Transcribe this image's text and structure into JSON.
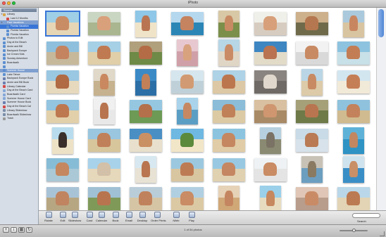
{
  "window": {
    "title": "iPhoto"
  },
  "colors": {
    "close": "#ff5f57",
    "minimize": "#febc2e",
    "zoom": "#28c840",
    "selection": "#3875d7"
  },
  "sidebar": {
    "header": "Source",
    "items": [
      {
        "label": "Library",
        "icon": "library-icon",
        "indent": 0,
        "disclosure": true
      },
      {
        "label": "Last 12 Months",
        "icon": "calendar-icon",
        "indent": 1
      },
      {
        "label": "Past Vacations",
        "icon": "folder-icon",
        "indent": 0,
        "disclosure": true,
        "state": "selected"
      },
      {
        "label": "Florida Vacation",
        "icon": "album-icon",
        "indent": 1,
        "state": "active"
      },
      {
        "label": "Florida Vacation",
        "icon": "album-icon",
        "indent": 1
      },
      {
        "label": "Florida Vacation",
        "icon": "album-icon",
        "indent": 1
      },
      {
        "label": "Photos to Edit",
        "icon": "album-icon",
        "indent": 0
      },
      {
        "label": "Day at the Beach",
        "icon": "album-icon",
        "indent": 0
      },
      {
        "label": "Annie and Bill",
        "icon": "album-icon",
        "indent": 0
      },
      {
        "label": "Backpack Europe",
        "icon": "album-icon",
        "indent": 0
      },
      {
        "label": "Ice Cream Kids",
        "icon": "album-icon",
        "indent": 0
      },
      {
        "label": "Sunday Adventure",
        "icon": "album-icon",
        "indent": 0
      },
      {
        "label": "Boardwalk",
        "icon": "album-icon",
        "indent": 0
      },
      {
        "label": "",
        "icon": "album-icon",
        "indent": 0
      },
      {
        "label": "Summer House",
        "icon": "album-icon",
        "indent": 0,
        "state": "selected"
      },
      {
        "label": "Lake Tahoe",
        "icon": "album-icon",
        "indent": 0
      },
      {
        "label": "Backpack Europe Book",
        "icon": "book-icon",
        "indent": 0
      },
      {
        "label": "Annie and Bill Book",
        "icon": "book-icon",
        "indent": 0
      },
      {
        "label": "Library Calendar",
        "icon": "calendar-icon",
        "indent": 0
      },
      {
        "label": "Day at the Beach Card",
        "icon": "card-icon",
        "indent": 0
      },
      {
        "label": "Boardwalk Card",
        "icon": "card-icon",
        "indent": 0
      },
      {
        "label": "Summer House Card",
        "icon": "card-icon",
        "indent": 0
      },
      {
        "label": "Summer House Book",
        "icon": "book-icon",
        "indent": 0
      },
      {
        "label": "Day at the Beach Cal",
        "icon": "calendar-icon",
        "indent": 0
      },
      {
        "label": "Library Slideshow",
        "icon": "slideshow-icon",
        "indent": 0
      },
      {
        "label": "Boardwalk Slideshow",
        "icon": "slideshow-icon",
        "indent": 0
      },
      {
        "label": "Trash",
        "icon": "trash-icon",
        "indent": 0
      }
    ]
  },
  "toolbar": [
    {
      "label": "Rotate",
      "icon": "rotate-icon"
    },
    {
      "label": "Edit",
      "icon": "edit-icon"
    },
    {
      "label": "Slideshow",
      "icon": "slideshow-icon"
    },
    {
      "label": "Card",
      "icon": "card-icon"
    },
    {
      "label": "Calendar",
      "icon": "calendar-icon"
    },
    {
      "label": "Book",
      "icon": "book-icon"
    },
    {
      "label": "Email",
      "icon": "email-icon"
    },
    {
      "label": "Desktop",
      "icon": "desktop-icon"
    },
    {
      "label": "Order Prints",
      "icon": "order-prints-icon"
    },
    {
      "label": "iWeb",
      "icon": "iweb-icon"
    },
    {
      "label": "Play",
      "icon": "play-icon"
    }
  ],
  "search": {
    "label": "Search",
    "placeholder": ""
  },
  "status": {
    "count_text": "1 of 54 photos"
  },
  "zoom": {
    "level": 0.5
  },
  "bottom_buttons": [
    {
      "label": "+",
      "icon": "add-icon"
    },
    {
      "label": "i",
      "icon": "info-icon"
    },
    {
      "label": "▦",
      "icon": "view-icon"
    },
    {
      "label": "↻",
      "icon": "rotate-icon"
    }
  ],
  "photos": [
    {
      "subject": "kids-on-beach",
      "sky": "#9ecfe6",
      "ground": "#e6d6b6",
      "skin": "#c98d66"
    },
    {
      "subject": "couple-smiling",
      "sky": "#c9d6c2",
      "ground": "#a9b68f",
      "skin": "#d9a07c"
    },
    {
      "subject": "beach-palm",
      "sky": "#8ec7e7",
      "ground": "#f0e4c8",
      "skin": "#b97552"
    },
    {
      "subject": "man-snorkel",
      "sky": "#b5d8ee",
      "ground": "#2b86b6",
      "skin": "#c58360"
    },
    {
      "subject": "cycling-couple",
      "sky": "#d8c8a6",
      "ground": "#7b8f4a",
      "skin": "#c88a63"
    },
    {
      "subject": "woman-hat",
      "sky": "#f0f0ea",
      "ground": "#d7ccc0",
      "skin": "#d7a07a"
    },
    {
      "subject": "cycling-group",
      "sky": "#cdb08c",
      "ground": "#6f6a4a",
      "skin": "#b5774f"
    },
    {
      "subject": "couple-beach",
      "sky": "#aac9dc",
      "ground": "#d8c4a0",
      "skin": "#c88660"
    },
    {
      "subject": "friends-portrait",
      "sky": "#8ec0dd",
      "ground": "#c6b89a",
      "skin": "#c48460"
    },
    {
      "subject": "kid-closeup",
      "sky": "#a6d0e6",
      "ground": "#e0cfa8",
      "skin": "#c07a52"
    },
    {
      "subject": "group-laughing",
      "sky": "#b0a07c",
      "ground": "#6e8a46",
      "skin": "#b36c45"
    },
    {
      "subject": "girls-smiling",
      "sky": "#e8c8d0",
      "ground": "#d0a0a8",
      "skin": "#d8a27e"
    },
    {
      "subject": "woman-portrait",
      "sky": "#b7d6e6",
      "ground": "#e0d6c6",
      "skin": "#c98b66"
    },
    {
      "subject": "man-portrait",
      "sky": "#3d86c2",
      "ground": "#e2dbc8",
      "skin": "#b97350"
    },
    {
      "subject": "beach-couple",
      "sky": "#f2f2f2",
      "ground": "#d9d9d9",
      "skin": "#c88a63"
    },
    {
      "subject": "woman-sea",
      "sky": "#8dc3df",
      "ground": "#c8e0e8",
      "skin": "#c37d55"
    },
    {
      "subject": "man-smiling",
      "sky": "#9ac7e2",
      "ground": "#e6d9bd",
      "skin": "#b06a44"
    },
    {
      "subject": "beach-group",
      "sky": "#e0d8c8",
      "ground": "#c6b28e",
      "skin": "#c9885f"
    },
    {
      "subject": "couple-blue",
      "sky": "#3b8ac6",
      "ground": "#2c6fa6",
      "skin": "#c18058"
    },
    {
      "subject": "girl-blue",
      "sky": "#d6e6ee",
      "ground": "#c0d0d8",
      "skin": "#d29a72"
    },
    {
      "subject": "selfie-group",
      "sky": "#aed2e6",
      "ground": "#dcc8a4",
      "skin": "#bc764e"
    },
    {
      "subject": "sand-writing",
      "sky": "#8a8480",
      "ground": "#6f6a65",
      "skin": "#e0d8cc"
    },
    {
      "subject": "friends-hug",
      "sky": "#bad6e6",
      "ground": "#dccaa8",
      "skin": "#c88a63"
    },
    {
      "subject": "boy-smile",
      "sky": "#d2e6f0",
      "ground": "#f2ead8",
      "skin": "#c57f57"
    },
    {
      "subject": "selfie-beach",
      "sky": "#93c4e0",
      "ground": "#e2d0aa",
      "skin": "#bd7850"
    },
    {
      "subject": "cartwheel",
      "sky": "#f0f0f0",
      "ground": "#e8e8e8",
      "skin": "#b8744e"
    },
    {
      "subject": "man-tree",
      "sky": "#95c7e1",
      "ground": "#6d9a55",
      "skin": "#b3704a"
    },
    {
      "subject": "group-snorkel",
      "sky": "#a9d3ea",
      "ground": "#5b9ec4",
      "skin": "#c68862"
    },
    {
      "subject": "kid-beach",
      "sky": "#8bbcd8",
      "ground": "#dccaa4",
      "skin": "#c08058"
    },
    {
      "subject": "girl-smile",
      "sky": "#d8c0a0",
      "ground": "#a88a66",
      "skin": "#cf9670"
    },
    {
      "subject": "kids-group",
      "sky": "#a6a079",
      "ground": "#6e7a48",
      "skin": "#b8754f"
    },
    {
      "subject": "couple-hat",
      "sky": "#8fc2dd",
      "ground": "#d0bb90",
      "skin": "#c3825b"
    },
    {
      "subject": "dog-beach",
      "sky": "#b8dced",
      "ground": "#eee2c6",
      "skin": "#3a2f2a"
    },
    {
      "subject": "couple-cap",
      "sky": "#9ac6df",
      "ground": "#d7c59c",
      "skin": "#c0805a"
    },
    {
      "subject": "woman-hat2",
      "sky": "#4a8fc4",
      "ground": "#e8e0cc",
      "skin": "#c99064"
    },
    {
      "subject": "palm-tree",
      "sky": "#6fb8e2",
      "ground": "#f2e6c8",
      "skin": "#5b8a3c"
    },
    {
      "subject": "woman-laugh",
      "sky": "#8cc4e0",
      "ground": "#e0cca6",
      "skin": "#c58760"
    },
    {
      "subject": "ruins",
      "sky": "#b7d0df",
      "ground": "#8a8a72",
      "skin": "#7a7264"
    },
    {
      "subject": "man-blue",
      "sky": "#c8dbe6",
      "ground": "#d7e2ea",
      "skin": "#b97a54"
    },
    {
      "subject": "swimmer",
      "sky": "#5eb2d8",
      "ground": "#2f93c4",
      "skin": "#c28760"
    },
    {
      "subject": "couple-water",
      "sky": "#87bcd6",
      "ground": "#aac8d6",
      "skin": "#c58760"
    },
    {
      "subject": "dog-lying",
      "sky": "#a8d2ea",
      "ground": "#e6d8bb",
      "skin": "#d2c0a8"
    },
    {
      "subject": "runner",
      "sky": "#d7e8f0",
      "ground": "#e7e2d4",
      "skin": "#b87550"
    },
    {
      "subject": "beach-crowd",
      "sky": "#9cc8df",
      "ground": "#d8c6a0",
      "skin": "#bd7b54"
    },
    {
      "subject": "couple-laugh",
      "sky": "#99c9e2",
      "ground": "#e0d1b1",
      "skin": "#c48762"
    },
    {
      "subject": "woman-white",
      "sky": "#eef2f4",
      "ground": "#e4e4e4",
      "skin": "#c98c64"
    },
    {
      "subject": "dock-hut",
      "sky": "#c8c2b6",
      "ground": "#6c9ec0",
      "skin": "#8a7a62"
    },
    {
      "subject": "woman-blue",
      "sky": "#cfe3ee",
      "ground": "#3a8ec6",
      "skin": "#c98f66"
    },
    {
      "subject": "tourists-ruins",
      "sky": "#a9c3d6",
      "ground": "#b7a682",
      "skin": "#c08460"
    },
    {
      "subject": "group-hats",
      "sky": "#a0c0d4",
      "ground": "#7f9a58",
      "skin": "#b8744e"
    },
    {
      "subject": "reflection",
      "sky": "#b9cdd9",
      "ground": "#d6c5a5",
      "skin": "#c0825c"
    },
    {
      "subject": "two-women",
      "sky": "#b0cfe1",
      "ground": "#dbc9a4",
      "skin": "#c98c64"
    },
    {
      "subject": "couple-sun",
      "sky": "#e6d2b6",
      "ground": "#d0a878",
      "skin": "#c48660"
    },
    {
      "subject": "wave-beach",
      "sky": "#9ad0ea",
      "ground": "#e8dcc0",
      "skin": "#c6885f"
    },
    {
      "subject": "woman-closeup",
      "sky": "#e0c6b6",
      "ground": "#b89c8c",
      "skin": "#c98b66"
    },
    {
      "subject": "man-hat",
      "sky": "#b9d7e8",
      "ground": "#e2d4b4",
      "skin": "#bc7a52"
    },
    {
      "subject": "girls-friends",
      "sky": "#95c3dd",
      "ground": "#ddc9a2",
      "skin": "#c58660"
    }
  ]
}
